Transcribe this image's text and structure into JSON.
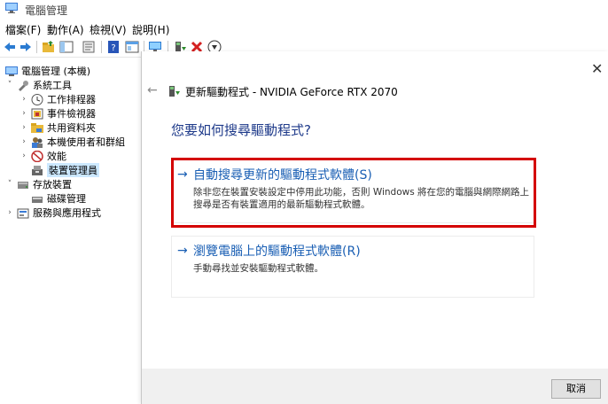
{
  "window": {
    "title": "電腦管理"
  },
  "menu": [
    "檔案(F)",
    "動作(A)",
    "檢視(V)",
    "說明(H)"
  ],
  "toolbar": {
    "icons": [
      "back-arrow-icon",
      "forward-arrow-icon",
      "folder-up-icon",
      "show-tree-icon",
      "properties-icon",
      "help-icon",
      "console-icon",
      "monitor-icon",
      "update-driver-icon",
      "uninstall-icon",
      "download-icon"
    ]
  },
  "tree": {
    "root": "電腦管理 (本機)",
    "system_tools": "系統工具",
    "task_scheduler": "工作排程器",
    "event_viewer": "事件檢視器",
    "shared_folders": "共用資料夾",
    "local_users": "本機使用者和群組",
    "performance": "效能",
    "device_manager": "裝置管理員",
    "storage": "存放裝置",
    "disk_management": "磁碟管理",
    "services": "服務與應用程式"
  },
  "dialog": {
    "header": "更新驅動程式 - NVIDIA GeForce RTX 2070",
    "question": "您要如何搜尋驅動程式?",
    "option1": {
      "title": "自動搜尋更新的驅動程式軟體(S)",
      "desc": "除非您在裝置安裝設定中停用此功能，否則 Windows 將在您的電腦與網際網路上搜尋是否有裝置適用的最新驅動程式軟體。"
    },
    "option2": {
      "title": "瀏覽電腦上的驅動程式軟體(R)",
      "desc": "手動尋找並安裝驅動程式軟體。"
    },
    "cancel": "取消"
  },
  "colors": {
    "link": "#1a5fb4",
    "highlight": "#d40000",
    "selection": "#cce8ff"
  }
}
